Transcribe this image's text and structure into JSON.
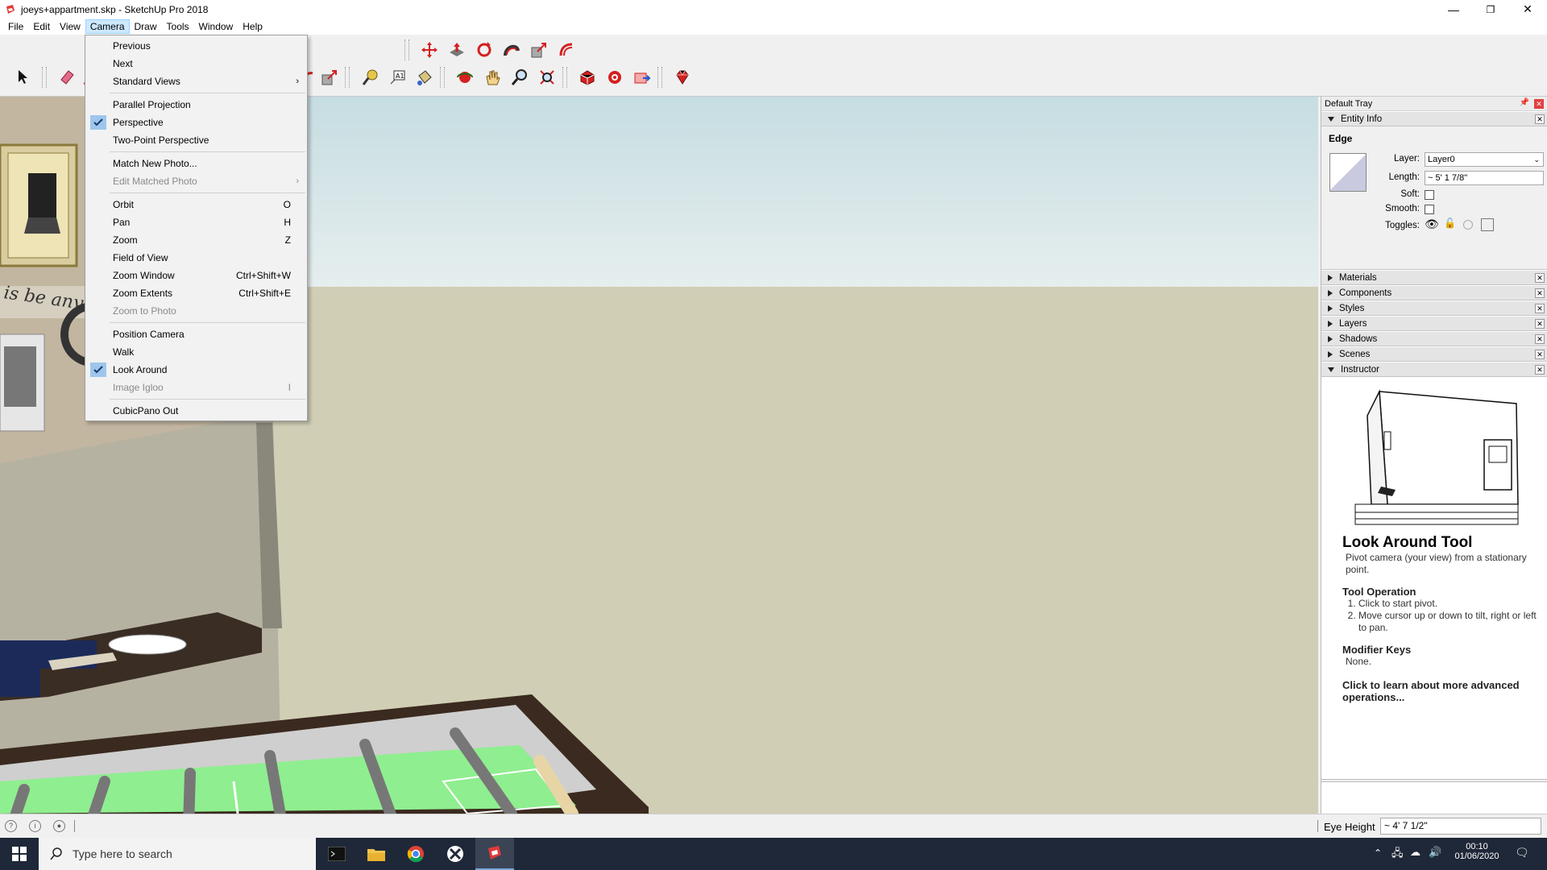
{
  "window": {
    "title": "joeys+appartment.skp - SketchUp Pro 2018",
    "minimize": "—",
    "restore": "❐",
    "close": "✕"
  },
  "menubar": {
    "items": [
      "File",
      "Edit",
      "View",
      "Camera",
      "Draw",
      "Tools",
      "Window",
      "Help"
    ],
    "active": "Camera"
  },
  "camera_menu": {
    "previous": "Previous",
    "next": "Next",
    "standard_views": "Standard Views",
    "parallel_projection": "Parallel Projection",
    "perspective": "Perspective",
    "two_point_perspective": "Two-Point Perspective",
    "match_new_photo": "Match New Photo...",
    "edit_matched_photo": "Edit Matched Photo",
    "orbit": "Orbit",
    "orbit_key": "O",
    "pan": "Pan",
    "pan_key": "H",
    "zoom": "Zoom",
    "zoom_key": "Z",
    "field_of_view": "Field of View",
    "zoom_window": "Zoom Window",
    "zoom_window_key": "Ctrl+Shift+W",
    "zoom_extents": "Zoom Extents",
    "zoom_extents_key": "Ctrl+Shift+E",
    "zoom_to_photo": "Zoom to Photo",
    "position_camera": "Position Camera",
    "walk": "Walk",
    "look_around": "Look Around",
    "image_igloo": "Image Igloo",
    "image_igloo_key": "I",
    "cubicpano_out": "CubicPano Out"
  },
  "tray": {
    "title": "Default Tray",
    "entity_info": {
      "header": "Entity Info",
      "type": "Edge",
      "layer_label": "Layer:",
      "layer_value": "Layer0",
      "length_label": "Length:",
      "length_value": "~ 5' 1 7/8\"",
      "soft_label": "Soft:",
      "smooth_label": "Smooth:",
      "toggles_label": "Toggles:"
    },
    "panels": [
      "Materials",
      "Components",
      "Styles",
      "Layers",
      "Shadows",
      "Scenes"
    ],
    "instructor": {
      "header": "Instructor",
      "title": "Look Around Tool",
      "desc": "Pivot camera (your view) from a stationary point.",
      "op_heading": "Tool Operation",
      "op_steps": [
        "Click to start pivot.",
        "Move cursor up or down to tilt, right or left to pan."
      ],
      "mod_heading": "Modifier Keys",
      "mod_text": "None.",
      "more": "Click to learn about more advanced operations..."
    }
  },
  "statusbar": {
    "vcb_label": "Eye Height",
    "vcb_value": "~ 4' 7 1/2\""
  },
  "taskbar": {
    "search_placeholder": "Type here to search",
    "time": "00:10",
    "date": "01/06/2020"
  },
  "colors": {
    "accent": "#cce8ff",
    "check_bg": "#9ec6ec",
    "taskbar": "#1f2838",
    "table_green": "#8fee8f",
    "table_wood": "#3b2a1f"
  }
}
